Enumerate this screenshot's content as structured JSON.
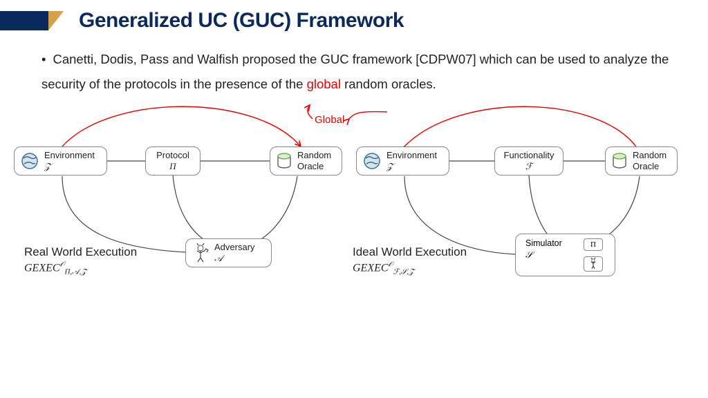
{
  "title": "Generalized UC (GUC) Framework",
  "bullet": {
    "pre": "Canetti, Dodis, Pass and Walfish proposed the GUC framework [CDPW07] which can be used to analyze the security of the protocols in the presence of the ",
    "red": "global",
    "post": " random oracles."
  },
  "global_label": "Global",
  "nodes": {
    "env1": {
      "label": "Environment",
      "sub": "𝒵"
    },
    "proto": {
      "label": "Protocol",
      "sub": "Π"
    },
    "ro1": {
      "label": "Random\nOracle"
    },
    "adv": {
      "label": "Adversary",
      "sub": "𝒜"
    },
    "env2": {
      "label": "Environment",
      "sub": "𝒵"
    },
    "func": {
      "label": "Functionality",
      "sub": "ℱ"
    },
    "ro2": {
      "label": "Random\nOracle"
    },
    "sim": {
      "label": "Simulator",
      "sub": "𝒮",
      "mini_pi": "Π"
    }
  },
  "exec": {
    "real": {
      "title": "Real World Execution",
      "sym": "GEXEC",
      "sup": "𝒪",
      "sub": "Π,𝒜,𝒵"
    },
    "ideal": {
      "title": "Ideal World Execution",
      "sym": "GEXEC",
      "sup": "𝒪",
      "sub": "ℱ,𝒮,𝒵"
    }
  }
}
